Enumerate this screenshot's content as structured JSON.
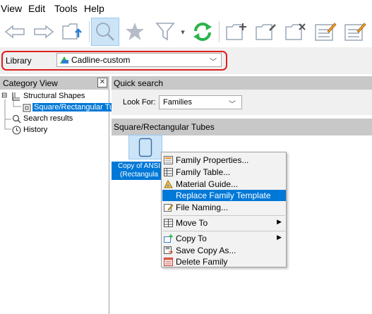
{
  "menubar": {
    "items": [
      "View",
      "Edit",
      "Tools",
      "Help"
    ]
  },
  "toolbar": {
    "icons": [
      "back-arrow-icon",
      "forward-arrow-icon",
      "folder-up-icon",
      "search-icon",
      "favorites-star-icon",
      "filter-icon",
      "refresh-icon",
      "new-folder-icon",
      "rename-folder-icon",
      "delete-folder-icon",
      "edit-table-icon",
      "edit-table-2-icon"
    ],
    "active_icon": "search-icon",
    "dropdown_caret": "▾"
  },
  "library": {
    "label": "Library",
    "selected": "Cadline-custom",
    "highlight_color": "#e01e1e"
  },
  "category_view": {
    "title": "Category View",
    "close_glyph": "✕",
    "tree": [
      {
        "label": "Structural Shapes",
        "icon": "structural-shape-icon",
        "expand": "⊟"
      },
      {
        "label": "Square/Rectangular Tubes",
        "icon": "tube-icon",
        "selected": true
      },
      {
        "label": "Search results",
        "icon": "search-icon"
      },
      {
        "label": "History",
        "icon": "history-icon"
      }
    ]
  },
  "quick_search": {
    "title": "Quick search",
    "look_for_label": "Look For:",
    "look_for_value": "Families"
  },
  "content": {
    "title": "Square/Rectangular Tubes",
    "family": {
      "caption_line1": "Copy of ANSI",
      "caption_line2": "(Rectangula"
    }
  },
  "context_menu": {
    "items": [
      {
        "label": "Family Properties...",
        "icon": "family-properties-icon"
      },
      {
        "label": "Family Table...",
        "icon": "family-table-icon"
      },
      {
        "label": "Material Guide...",
        "icon": "material-guide-icon"
      },
      {
        "label": "Replace Family Template",
        "icon": "",
        "highlighted": true
      },
      {
        "label": "File Naming...",
        "icon": "file-naming-icon"
      },
      {
        "label": "Move To",
        "icon": "move-to-icon",
        "submenu": "▶"
      },
      {
        "label": "Copy To",
        "icon": "copy-to-icon",
        "submenu": "▶"
      },
      {
        "label": "Save Copy As...",
        "icon": "save-copy-icon"
      },
      {
        "label": "Delete Family",
        "icon": "delete-family-icon"
      }
    ]
  },
  "colors": {
    "selection": "#0078d7",
    "header_bg": "#c8c8c8",
    "toolbar_icon": "#9aa7b8",
    "refresh_green": "#2bb44a",
    "highlight_border": "#e01e1e"
  }
}
